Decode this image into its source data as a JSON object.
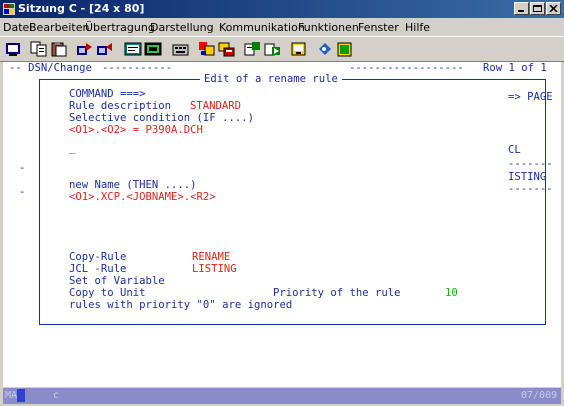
{
  "window": {
    "title": "Sitzung C - [24 x 80]",
    "controls": [
      "minimize-icon",
      "maximize-icon",
      "close-icon"
    ]
  },
  "menubar": {
    "items": [
      "Datei",
      "Bearbeiten",
      "Übertragung",
      "Darstellung",
      "Kommunikation",
      "Funktionen",
      "Fenster",
      "Hilfe"
    ]
  },
  "toolbar": {
    "icons": [
      "print-screen-icon",
      "copy-icon",
      "paste-icon",
      "send-file-icon",
      "receive-file-icon",
      "display-icon",
      "macro-icon",
      "keyboard-map-icon",
      "color-icon",
      "start-record-icon",
      "stop-record-icon",
      "play-icon",
      "connect-icon",
      "help-icon"
    ]
  },
  "terminal": {
    "header_left": "-- DSN/Change",
    "header_right": "Row 1 of 1",
    "right_page": "=> PAGE",
    "right_cl": "CL",
    "right_dash1": "-------",
    "right_listing": "ISTING",
    "right_dash2": "-------",
    "left_marker1": "-",
    "left_marker2": "-"
  },
  "dialog": {
    "title": "Edit of a rename rule",
    "command_label": "COMMAND ===>",
    "rule_desc_label": "Rule description",
    "rule_desc_value": "STANDARD",
    "selective_label": "Selective condition (IF ....)",
    "selective_value": "<O1>.<O2> = P390A.DCH",
    "cursor_line": "_",
    "new_name_label": "new Name (THEN ....)",
    "new_name_value": "<O1>.XCP.<JOBNAME>.<R2>",
    "copy_rule_label": "Copy-Rule",
    "copy_rule_value": "RENAME",
    "jcl_rule_label": "JCL -Rule",
    "jcl_rule_value": "LISTING",
    "set_var_label": "Set of Variable",
    "copy_unit_label": "Copy to Unit",
    "priority_label": "Priority of the rule",
    "priority_value": "10",
    "footer_note": "rules with priority \"0\" are ignored"
  },
  "statusbar": {
    "mode": "MA",
    "session": "c",
    "position": "07/009"
  }
}
